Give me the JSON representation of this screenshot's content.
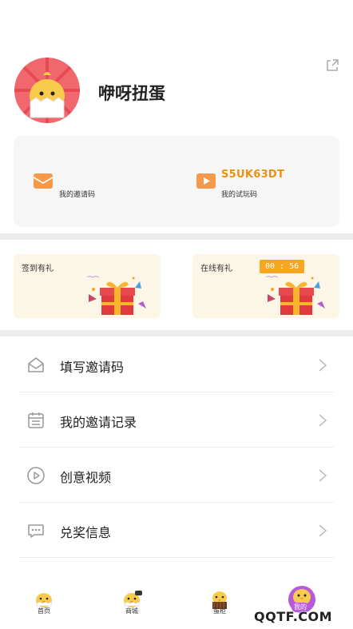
{
  "profile": {
    "username": "咿呀扭蛋"
  },
  "codes": {
    "invite_label": "我的邀请码",
    "trial_value": "S5UK63DT",
    "trial_label": "我的试玩码"
  },
  "promos": {
    "signin_title": "签到有礼",
    "online_title": "在线有礼",
    "online_timer": "00 : 56"
  },
  "menu": {
    "items": [
      {
        "label": "填写邀请码",
        "icon": "envelope-icon"
      },
      {
        "label": "我的邀请记录",
        "icon": "calendar-icon"
      },
      {
        "label": "创意视频",
        "icon": "play-icon"
      },
      {
        "label": "兑奖信息",
        "icon": "chat-icon"
      }
    ]
  },
  "tabs": {
    "items": [
      {
        "label": "首页"
      },
      {
        "label": "商城"
      },
      {
        "label": "蛋柜"
      },
      {
        "label": "我的"
      }
    ]
  },
  "watermark": "QQTF.COM",
  "colors": {
    "accent": "#f5a623",
    "code_value": "#e8920f",
    "avatar_bg": "#f0686e",
    "promo_bg": "#fcf6e6"
  }
}
